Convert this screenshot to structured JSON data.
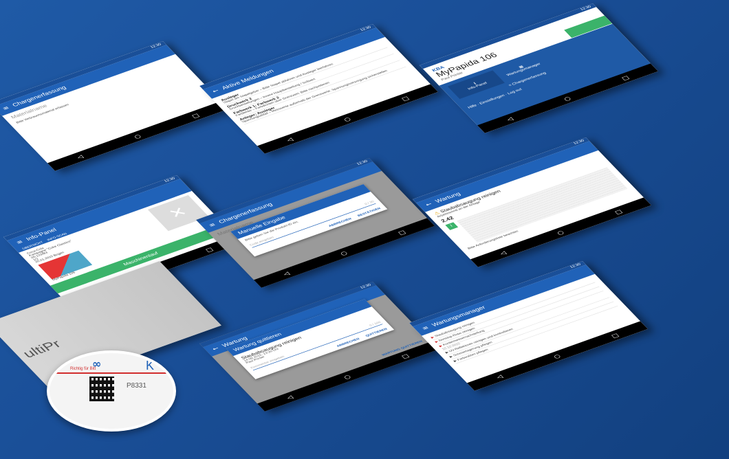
{
  "screens": {
    "charge": {
      "title": "Chargenerfassung",
      "placeholder": "Materialname",
      "hint": "Bitte Verbrauchsmaterial erfassen"
    },
    "meldungen": {
      "title": "Aktive Meldungen",
      "items": [
        {
          "label": "Ausleger",
          "text": "Stapel am Stapelgeber – Bitte Stapel abfahren und Ausleger leerfahren"
        },
        {
          "label": "Druckwerk 2",
          "text": "Druckbeistellungen – Innere Hauptbeistellung / Sollwert"
        },
        {
          "label": "Farbwerk 1: Farbwerk 2",
          "text": "Farbfehler – Farbdichten über Grenzwert. Bitte nachjustieren"
        },
        {
          "label": "Anleger; Ausleger",
          "text": "Spannungsabfall – Messwerte außerhalb der Grenzwerte. Spannungsversorgung sicherstellen"
        }
      ]
    },
    "mypapida": {
      "brand": "KBA",
      "title": "MyPapida 106",
      "user": "Paul Printer",
      "tiles": [
        "Info-Panel",
        "Wartungsmanager",
        "Chargenerfassung"
      ],
      "menu": [
        "Hilfe",
        "Einstellungen",
        "Log out"
      ]
    },
    "infopanel": {
      "title": "Info-Panel",
      "tabs": [
        "ÜBERSICHT",
        "INFO-SCAN"
      ],
      "fields": [
        "Coca-Cola",
        "Kampagne \"Coke Classics\"",
        "05-123/B3",
        "1/1",
        "25.01.2015 Bogen"
      ],
      "caption": "MyPapida 106",
      "button": "Maschinenlauf"
    },
    "manuell": {
      "screen_title": "Chargenerfassung",
      "screen_sub": "Materialname",
      "dialog_title": "Manuelle Eingabe",
      "prompt": "Bitte geben Sie die Produkt-ID ein.",
      "field_placeholder": "Code eingeben",
      "counter": "0 / 20",
      "cancel": "ABBRECHEN",
      "confirm": "BESTÄTIGEN"
    },
    "wartung": {
      "title": "Wartung",
      "heading": "Staubabsaugung reinigen",
      "sub": "Arbeitsschritt an der Anlage",
      "step": "2.42",
      "footer": "Bitte Anforderungsliste beachten"
    },
    "quittieren": {
      "screen_title": "Wartung",
      "dialog_title": "Wartung quittieren",
      "heading": "Staubabsaugung reinigen",
      "date": "14.09.2015, 13:30 Uhr",
      "user": "Paul Printer",
      "field_placeholder": "Kommentar eingeben",
      "counter": "0 / 100",
      "cancel": "ABBRECHEN",
      "confirm": "QUITTIEREN",
      "footer_btn": "WARTUNG QUITTIEREN"
    },
    "manager": {
      "title": "Wartungsmanager",
      "items": [
        "Staubabsaugung reinigen",
        "Nonstop-Robo reinigen",
        "Kontermessernachstellung",
        "UV-Reflektoren reinigen und kontrollieren",
        "Schmierlagerung pflegen",
        "Farbwalzen pflegen"
      ],
      "date_label": "15.10.2015"
    },
    "scan": {
      "brand_text": "K",
      "label_red": "Richtig für Bitt",
      "article": "P8331",
      "side_text": "ultiPr"
    },
    "status_time": "12:30"
  },
  "colors": {
    "background": "#1a4f98",
    "appbar": "#2062b8",
    "green": "#3bb36a",
    "red": "#d12d2d"
  }
}
